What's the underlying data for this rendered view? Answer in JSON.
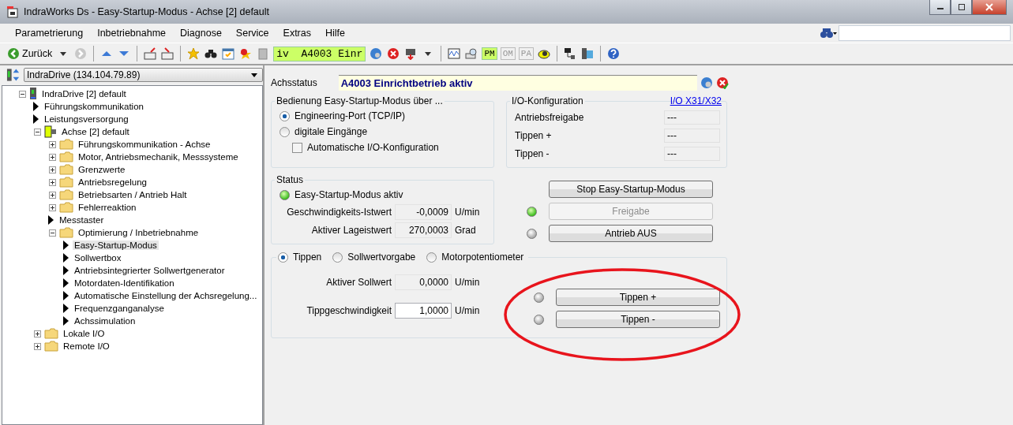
{
  "window": {
    "title": "IndraWorks Ds - Easy-Startup-Modus - Achse [2] default"
  },
  "menu": [
    "Parametrierung",
    "Inbetriebnahme",
    "Diagnose",
    "Service",
    "Extras",
    "Hilfe"
  ],
  "toolbar": {
    "back_label": "Zurück",
    "status_text": "iv  A4003 Einr",
    "modes": [
      {
        "label": "PM",
        "active": true
      },
      {
        "label": "OM",
        "active": false
      },
      {
        "label": "PA",
        "active": false
      }
    ]
  },
  "device_selector": {
    "value": "IndraDrive (134.104.79.89)"
  },
  "tree": [
    {
      "label": "IndraDrive [2] default",
      "kind": "device",
      "expanded": true,
      "selected": false,
      "children": [
        {
          "label": "Führungskommunikation",
          "kind": "leaf",
          "selected": false
        },
        {
          "label": "Leistungsversorgung",
          "kind": "leaf",
          "selected": false
        },
        {
          "label": "Achse [2] default",
          "kind": "axis",
          "expanded": true,
          "selected": false,
          "children": [
            {
              "label": "Führungskommunikation - Achse",
              "kind": "folder",
              "expanded": false,
              "selected": false
            },
            {
              "label": "Motor, Antriebsmechanik, Messsysteme",
              "kind": "folder",
              "expanded": false,
              "selected": false
            },
            {
              "label": "Grenzwerte",
              "kind": "folder",
              "expanded": false,
              "selected": false
            },
            {
              "label": "Antriebsregelung",
              "kind": "folder",
              "expanded": false,
              "selected": false
            },
            {
              "label": "Betriebsarten / Antrieb Halt",
              "kind": "folder",
              "expanded": false,
              "selected": false
            },
            {
              "label": "Fehlerreaktion",
              "kind": "folder",
              "expanded": false,
              "selected": false
            },
            {
              "label": "Messtaster",
              "kind": "leaf",
              "selected": false
            },
            {
              "label": "Optimierung / Inbetriebnahme",
              "kind": "folder",
              "expanded": true,
              "selected": false,
              "children": [
                {
                  "label": "Easy-Startup-Modus",
                  "kind": "leaf",
                  "selected": true
                },
                {
                  "label": "Sollwertbox",
                  "kind": "leaf",
                  "selected": false
                },
                {
                  "label": "Antriebsintegrierter Sollwertgenerator",
                  "kind": "leaf",
                  "selected": false
                },
                {
                  "label": "Motordaten-Identifikation",
                  "kind": "leaf",
                  "selected": false
                },
                {
                  "label": "Automatische Einstellung der Achsregelung...",
                  "kind": "leaf",
                  "selected": false
                },
                {
                  "label": "Frequenzganganalyse",
                  "kind": "leaf",
                  "selected": false
                },
                {
                  "label": "Achssimulation",
                  "kind": "leaf",
                  "selected": false
                }
              ]
            }
          ]
        },
        {
          "label": "Lokale I/O",
          "kind": "folder",
          "expanded": false,
          "selected": false
        },
        {
          "label": "Remote I/O",
          "kind": "folder",
          "expanded": false,
          "selected": false
        }
      ]
    }
  ],
  "axis_status": {
    "label": "Achsstatus",
    "value": "A4003 Einrichtbetrieb aktiv"
  },
  "operation_group": {
    "title": "Bedienung Easy-Startup-Modus über ...",
    "options": [
      {
        "label": "Engineering-Port (TCP/IP)",
        "selected": true
      },
      {
        "label": "digitale Eingänge",
        "selected": false
      }
    ],
    "auto_io": {
      "label": "Automatische I/O-Konfiguration",
      "checked": false
    }
  },
  "io_group": {
    "title": "I/O-Konfiguration",
    "link": "I/O X31/X32",
    "rows": [
      {
        "label": "Antriebsfreigabe",
        "value": "---"
      },
      {
        "label": "Tippen +",
        "value": "---"
      },
      {
        "label": "Tippen -",
        "value": "---"
      }
    ]
  },
  "status_group": {
    "title": "Status",
    "indicator": {
      "label": "Easy-Startup-Modus aktiv",
      "on": true
    },
    "rows": [
      {
        "label": "Geschwindigkeits-Istwert",
        "value": "-0,0009",
        "unit": "U/min"
      },
      {
        "label": "Aktiver Lageistwert",
        "value": "270,0003",
        "unit": "Grad"
      }
    ]
  },
  "drive_buttons": [
    {
      "label": "Stop Easy-Startup-Modus",
      "kind": "plain",
      "disabled": false
    },
    {
      "label": "Freigabe",
      "kind": "lamp",
      "lamp_on": true,
      "disabled": true
    },
    {
      "label": "Antrieb AUS",
      "kind": "lamp",
      "lamp_on": false,
      "disabled": false
    }
  ],
  "jog_group": {
    "modes": [
      {
        "label": "Tippen",
        "selected": true
      },
      {
        "label": "Sollwertvorgabe",
        "selected": false
      },
      {
        "label": "Motorpotentiometer",
        "selected": false
      }
    ],
    "rows": [
      {
        "label": "Aktiver Sollwert",
        "value": "0,0000",
        "unit": "U/min",
        "editable": false
      },
      {
        "label": "Tippgeschwindigkeit",
        "value": "1,0000",
        "unit": "U/min",
        "editable": true
      }
    ],
    "buttons": [
      {
        "label": "Tippen +",
        "lamp_on": false
      },
      {
        "label": "Tippen -",
        "lamp_on": false
      }
    ]
  }
}
